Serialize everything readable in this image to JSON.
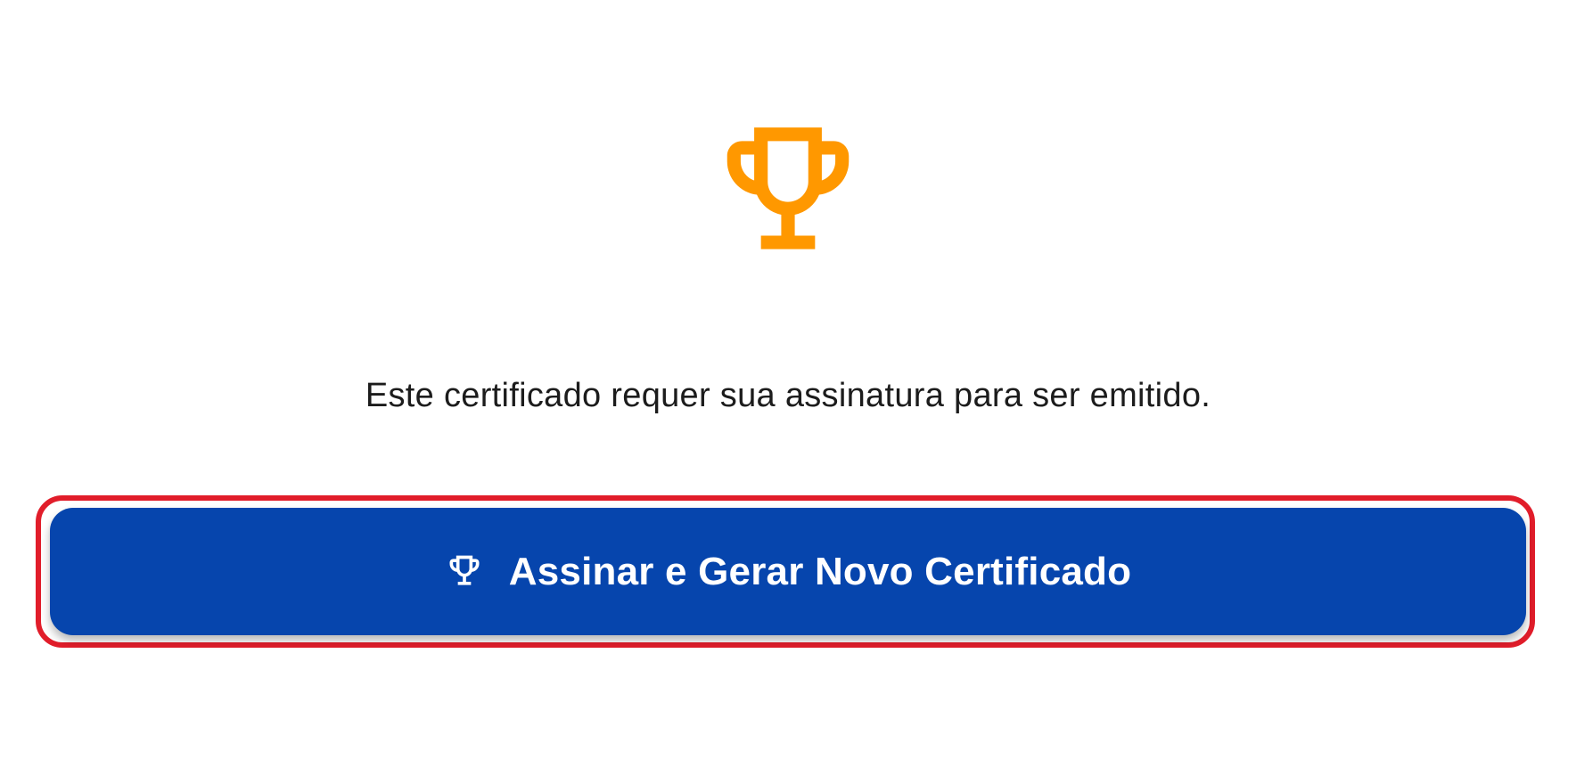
{
  "hero": {
    "icon": "trophy-icon",
    "icon_color": "#FF9800"
  },
  "message": {
    "text": "Este certificado requer sua assinatura para ser emitido."
  },
  "cta": {
    "label": "Assinar e Gerar Novo Certificado",
    "icon": "trophy-icon",
    "background_color": "#0645AD",
    "text_color": "#FFFFFF"
  },
  "highlight": {
    "color": "#E11D2A"
  }
}
